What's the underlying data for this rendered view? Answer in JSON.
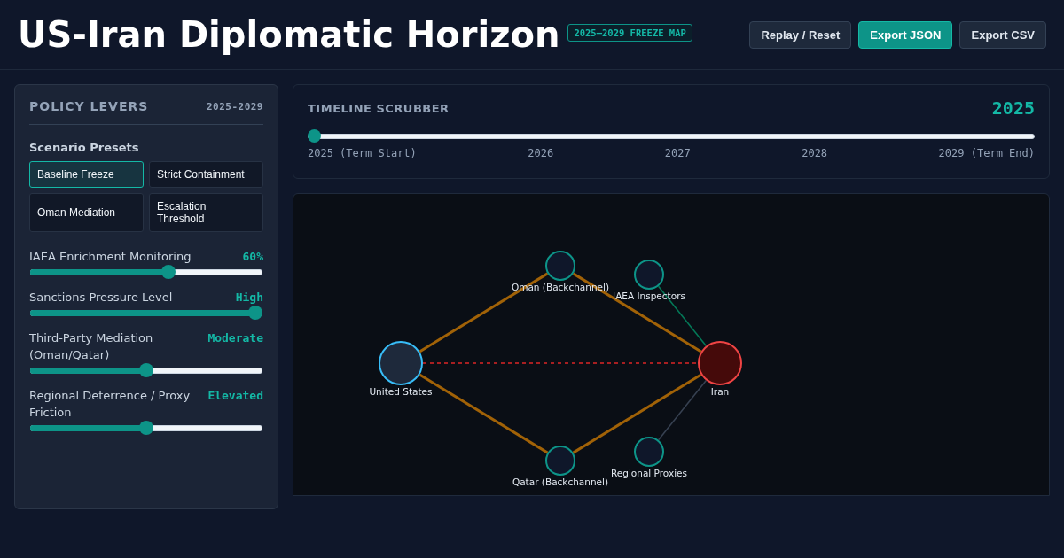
{
  "header": {
    "title": "US-Iran Diplomatic Horizon",
    "badge": "2025–2029 FREEZE MAP",
    "buttons": [
      {
        "label": "Replay / Reset",
        "kind": "plain"
      },
      {
        "label": "Export JSON",
        "kind": "primary"
      },
      {
        "label": "Export CSV",
        "kind": "plain"
      }
    ]
  },
  "policy_levers": {
    "title": "POLICY LEVERS",
    "range": "2025-2029",
    "presets_title": "Scenario Presets",
    "presets": [
      {
        "label": "Baseline Freeze",
        "selected": true
      },
      {
        "label": "Strict Containment",
        "selected": false
      },
      {
        "label": "Oman Mediation",
        "selected": false
      },
      {
        "label": "Escalation Threshold",
        "selected": false
      }
    ],
    "sliders": [
      {
        "label": "IAEA Enrichment Monitoring",
        "reading": "60%",
        "level": 0.6
      },
      {
        "label": "Sanctions Pressure Level",
        "reading": "High",
        "level": 1
      },
      {
        "label": "Third-Party Mediation (Oman/Qatar)",
        "reading": "Moderate",
        "level": 0.5
      },
      {
        "label": "Regional Deterrence / Proxy Friction",
        "reading": "Elevated",
        "level": 0.5
      }
    ]
  },
  "timeline": {
    "title": "TIMELINE SCRUBBER",
    "year": "2025",
    "level": 0,
    "ticks": [
      "2025 (Term Start)",
      "2026",
      "2027",
      "2028",
      "2029 (Term End)"
    ]
  },
  "network": {
    "nodes": [
      {
        "label": "United States",
        "kind": "us"
      },
      {
        "label": "Iran",
        "kind": "iran"
      },
      {
        "label": "Oman (Backchannel)",
        "kind": "intermediary"
      },
      {
        "label": "IAEA Inspectors",
        "kind": "intermediary"
      },
      {
        "label": "Qatar (Backchannel)",
        "kind": "intermediary"
      },
      {
        "label": "Regional Proxies",
        "kind": "intermediary"
      }
    ],
    "links": [
      {
        "kind": "backchannel"
      },
      {
        "kind": "backchannel"
      },
      {
        "kind": "backchannel"
      },
      {
        "kind": "backchannel"
      },
      {
        "kind": "hostile"
      },
      {
        "kind": "monitoring"
      },
      {
        "kind": "proxy"
      }
    ]
  }
}
